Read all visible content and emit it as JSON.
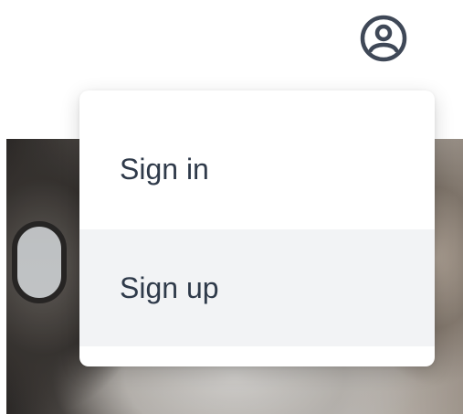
{
  "header": {
    "account_icon": "user-circle-icon",
    "icon_color": "#3f4857"
  },
  "account_menu": {
    "items": [
      {
        "label": "Sign in"
      },
      {
        "label": "Sign up",
        "highlighted": true
      }
    ],
    "text_color": "#2f3a4a",
    "hover_background": "#f2f3f5"
  }
}
